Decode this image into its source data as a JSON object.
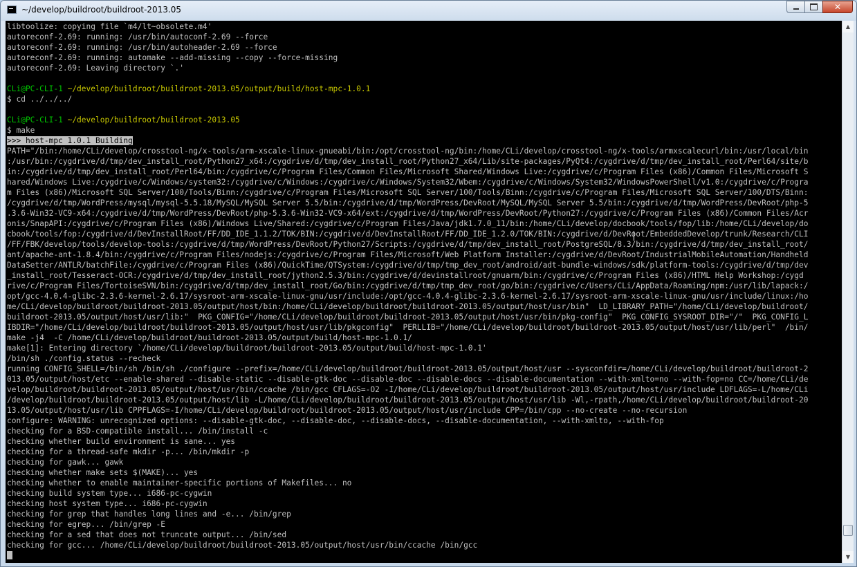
{
  "window": {
    "title": "~/develop/buildroot/buildroot-2013.05",
    "buttons": {
      "minimize": "minimize",
      "maximize": "maximize",
      "close": "✕"
    }
  },
  "colors": {
    "console_bg": "#000000",
    "console_fg": "#c0c0c0",
    "prompt_user": "#00c800",
    "prompt_path": "#c8c800"
  },
  "terminal": {
    "lines": [
      {
        "t": "libtoolize: copying file `m4/lt~obsolete.m4'"
      },
      {
        "t": "autoreconf-2.69: running: /usr/bin/autoconf-2.69 --force"
      },
      {
        "t": "autoreconf-2.69: running: /usr/bin/autoheader-2.69 --force"
      },
      {
        "t": "autoreconf-2.69: running: automake --add-missing --copy --force-missing"
      },
      {
        "t": "autoreconf-2.69: Leaving directory `.'"
      },
      {
        "t": ""
      },
      {
        "kind": "prompt",
        "user": "CLi@PC-CLI-1",
        "path": "~/develop/buildroot/buildroot-2013.05/output/build/host-mpc-1.0.1"
      },
      {
        "t": "$ cd ../../../"
      },
      {
        "t": ""
      },
      {
        "kind": "prompt",
        "user": "CLi@PC-CLI-1",
        "path": "~/develop/buildroot/buildroot-2013.05"
      },
      {
        "t": "$ make"
      },
      {
        "kind": "highlight",
        "t": ">>> host-mpc 1.0.1 Building"
      },
      {
        "t": "PATH=\"/bin:/home/CLi/develop/crosstool-ng/x-tools/arm-xscale-linux-gnueabi/bin:/opt/crosstool-ng/bin:/home/CLi/develop/crosstool-ng/x-tools/armxscalecurl/bin:/usr/local/bin"
      },
      {
        "t": ":/usr/bin:/cygdrive/d/tmp/dev_install_root/Python27_x64:/cygdrive/d/tmp/dev_install_root/Python27_x64/Lib/site-packages/PyQt4:/cygdrive/d/tmp/dev_install_root/Perl64/site/b"
      },
      {
        "t": "in:/cygdrive/d/tmp/dev_install_root/Perl64/bin:/cygdrive/c/Program Files/Common Files/Microsoft Shared/Windows Live:/cygdrive/c/Program Files (x86)/Common Files/Microsoft S"
      },
      {
        "t": "hared/Windows Live:/cygdrive/c/Windows/system32:/cygdrive/c/Windows:/cygdrive/c/Windows/System32/Wbem:/cygdrive/c/Windows/System32/WindowsPowerShell/v1.0:/cygdrive/c/Progra"
      },
      {
        "t": "m Files (x86)/Microsoft SQL Server/100/Tools/Binn:/cygdrive/c/Program Files/Microsoft SQL Server/100/Tools/Binn:/cygdrive/c/Program Files/Microsoft SQL Server/100/DTS/Binn:"
      },
      {
        "t": "/cygdrive/d/tmp/WordPress/mysql/mysql-5.5.18/MySQL/MySQL Server 5.5/bin:/cygdrive/d/tmp/WordPress/DevRoot/MySQL/MySQL Server 5.5/bin:/cygdrive/d/tmp/WordPress/DevRoot/php-5"
      },
      {
        "t": ".3.6-Win32-VC9-x64:/cygdrive/d/tmp/WordPress/DevRoot/php-5.3.6-Win32-VC9-x64/ext:/cygdrive/d/tmp/WordPress/DevRoot/Python27:/cygdrive/c/Program Files (x86)/Common Files/Acr"
      },
      {
        "t": "onis/SnapAPI:/cygdrive/c/Program Files (x86)/Windows Live/Shared:/cygdrive/c/Program Files/Java/jdk1.7.0_11/bin:/home/CLi/develop/docbook/tools/fop/lib:/home/CLi/develop/do"
      },
      {
        "t": "cbook/tools/fop:/cygdrive/d/DevInstallRoot/FF/DD_IDE_1.1.2/TOK/BIN:/cygdrive/d/DevInstallRoot/FF/DD_IDE_1.2.0/TOK/BIN:/cygdrive/d/DevRoot/EmbeddedDevelop/trunk/Research/CLI"
      },
      {
        "t": "/FF/FBK/develop/tools/develop-tools:/cygdrive/d/tmp/WordPress/DevRoot/Python27/Scripts:/cygdrive/d/tmp/dev_install_root/PostgreSQL/8.3/bin:/cygdrive/d/tmp/dev_install_root/"
      },
      {
        "t": "ant/apache-ant-1.8.4/bin:/cygdrive/c/Program Files/nodejs:/cygdrive/c/Program Files/Microsoft/Web Platform Installer:/cygdrive/d/DevRoot/IndustrialMobileAutomation/Handheld"
      },
      {
        "t": "DataSetter/ANTLR/batchFile:/cygdrive/c/Program Files (x86)/QuickTime/QTSystem:/cygdrive/d/tmp/tmp_dev_root/android/adt-bundle-windows/sdk/platform-tools:/cygdrive/d/tmp/dev"
      },
      {
        "t": "_install_root/Tesseract-OCR:/cygdrive/d/tmp/dev_install_root/jython2.5.3/bin:/cygdrive/d/devinstallroot/gnuarm/bin:/cygdrive/c/Program Files (x86)/HTML Help Workshop:/cygd"
      },
      {
        "t": "rive/c/Program Files/TortoiseSVN/bin:/cygdrive/d/tmp/dev_install_root/Go/bin:/cygdrive/d/tmp/tmp_dev_root/go/bin:/cygdrive/c/Users/CLi/AppData/Roaming/npm:/usr/lib/lapack:/"
      },
      {
        "t": "opt/gcc-4.0.4-glibc-2.3.6-kernel-2.6.17/sysroot-arm-xscale-linux-gnu/usr/include:/opt/gcc-4.0.4-glibc-2.3.6-kernel-2.6.17/sysroot-arm-xscale-linux-gnu/usr/include/linux:/ho"
      },
      {
        "t": "me/CLi/develop/buildroot/buildroot-2013.05/output/host/bin:/home/CLi/develop/buildroot/buildroot-2013.05/output/host/usr/bin\"  LD_LIBRARY_PATH=\"/home/CLi/develop/buildroot/"
      },
      {
        "t": "buildroot-2013.05/output/host/usr/lib:\"  PKG_CONFIG=\"/home/CLi/develop/buildroot/buildroot-2013.05/output/host/usr/bin/pkg-config\"  PKG_CONFIG_SYSROOT_DIR=\"/\"  PKG_CONFIG_L"
      },
      {
        "t": "IBDIR=\"/home/CLi/develop/buildroot/buildroot-2013.05/output/host/usr/lib/pkgconfig\"  PERLLIB=\"/home/CLi/develop/buildroot/buildroot-2013.05/output/host/usr/lib/perl\"  /bin/"
      },
      {
        "t": "make -j4  -C /home/CLi/develop/buildroot/buildroot-2013.05/output/build/host-mpc-1.0.1/"
      },
      {
        "t": "make[1]: Entering directory `/home/CLi/develop/buildroot/buildroot-2013.05/output/build/host-mpc-1.0.1'"
      },
      {
        "t": "/bin/sh ./config.status --recheck"
      },
      {
        "t": "running CONFIG_SHELL=/bin/sh /bin/sh ./configure --prefix=/home/CLi/develop/buildroot/buildroot-2013.05/output/host/usr --sysconfdir=/home/CLi/develop/buildroot/buildroot-2"
      },
      {
        "t": "013.05/output/host/etc --enable-shared --disable-static --disable-gtk-doc --disable-doc --disable-docs --disable-documentation --with-xmlto=no --with-fop=no CC=/home/CLi/de"
      },
      {
        "t": "velop/buildroot/buildroot-2013.05/output/host/usr/bin/ccache /bin/gcc CFLAGS=-O2 -I/home/CLi/develop/buildroot/buildroot-2013.05/output/host/usr/include LDFLAGS=-L/home/CLi"
      },
      {
        "t": "/develop/buildroot/buildroot-2013.05/output/host/lib -L/home/CLi/develop/buildroot/buildroot-2013.05/output/host/usr/lib -Wl,-rpath,/home/CLi/develop/buildroot/buildroot-20"
      },
      {
        "t": "13.05/output/host/usr/lib CPPFLAGS=-I/home/CLi/develop/buildroot/buildroot-2013.05/output/host/usr/include CPP=/bin/cpp --no-create --no-recursion"
      },
      {
        "t": "configure: WARNING: unrecognized options: --disable-gtk-doc, --disable-doc, --disable-docs, --disable-documentation, --with-xmlto, --with-fop"
      },
      {
        "t": "checking for a BSD-compatible install... /bin/install -c"
      },
      {
        "t": "checking whether build environment is sane... yes"
      },
      {
        "t": "checking for a thread-safe mkdir -p... /bin/mkdir -p"
      },
      {
        "t": "checking for gawk... gawk"
      },
      {
        "t": "checking whether make sets $(MAKE)... yes"
      },
      {
        "t": "checking whether to enable maintainer-specific portions of Makefiles... no"
      },
      {
        "t": "checking build system type... i686-pc-cygwin"
      },
      {
        "t": "checking host system type... i686-pc-cygwin"
      },
      {
        "t": "checking for grep that handles long lines and -e... /bin/grep"
      },
      {
        "t": "checking for egrep... /bin/grep -E"
      },
      {
        "t": "checking for a sed that does not truncate output... /bin/sed"
      },
      {
        "t": "checking for gcc... /home/CLi/develop/buildroot/buildroot-2013.05/output/host/usr/bin/ccache /bin/gcc"
      },
      {
        "kind": "cursor"
      }
    ]
  },
  "scrollbar": {
    "up": "▲",
    "down": "▼",
    "position": 0.97
  }
}
